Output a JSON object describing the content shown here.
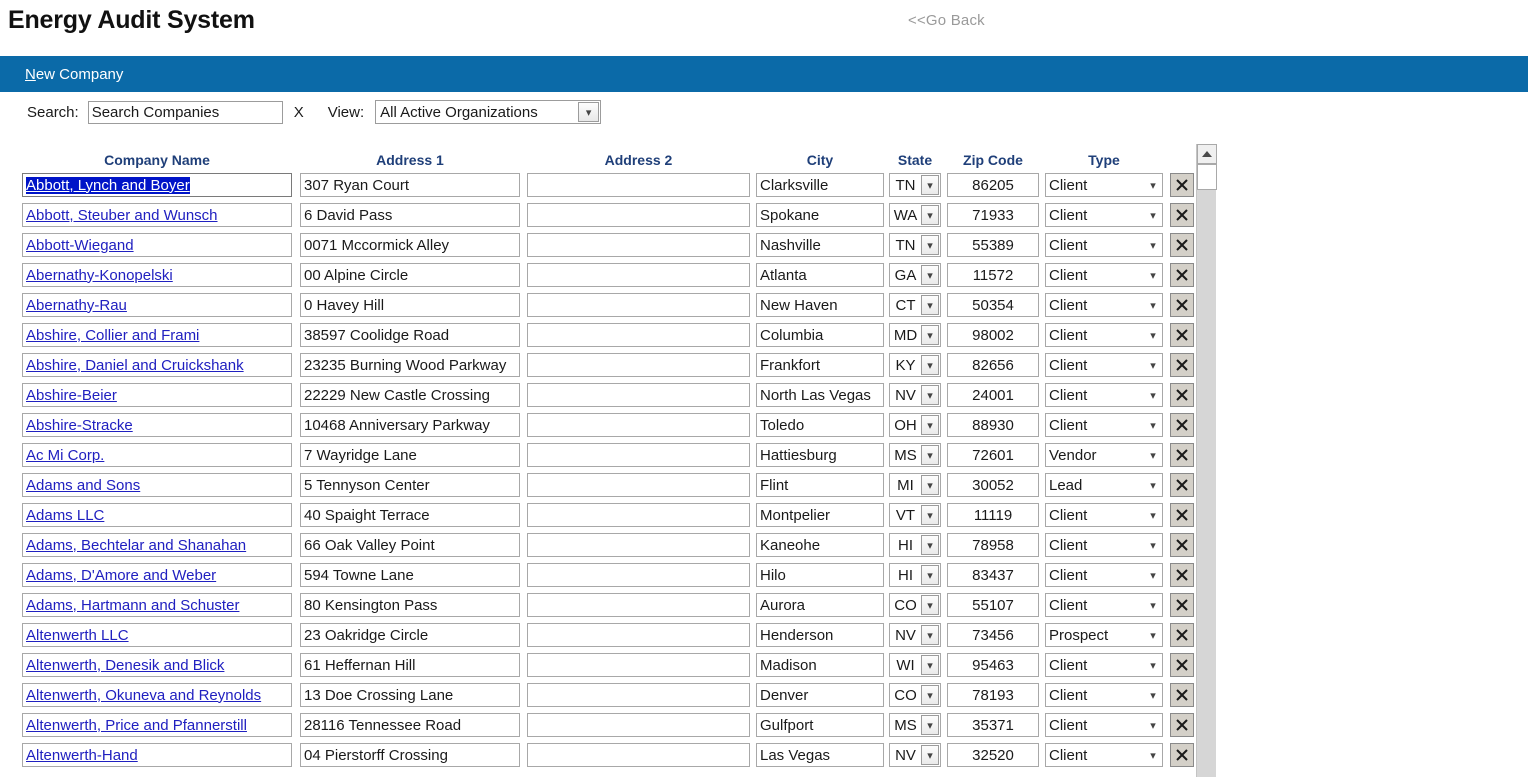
{
  "header": {
    "title": "Energy Audit System",
    "go_back_label": "<<Go Back"
  },
  "navbar": {
    "new_company_accel": "N",
    "new_company_rest": "ew Company"
  },
  "toolbar": {
    "search_label": "Search:",
    "search_value": "Search Companies",
    "search_placeholder": "Search Companies",
    "clear_label": "X",
    "view_label": "View:",
    "view_selected": "All Active Organizations",
    "view_options": [
      "All Active Organizations"
    ]
  },
  "grid": {
    "columns": [
      "Company Name",
      "Address 1",
      "Address 2",
      "City",
      "State",
      "Zip Code",
      "Type"
    ],
    "delete_icon": "x-icon",
    "selected_row_index": 0,
    "rows": [
      {
        "name": "Abbott, Lynch and Boyer",
        "address1": "307 Ryan Court",
        "address2": "",
        "city": "Clarksville",
        "state": "TN",
        "zip": "86205",
        "type": "Client"
      },
      {
        "name": "Abbott, Steuber and Wunsch",
        "address1": "6 David Pass",
        "address2": "",
        "city": "Spokane",
        "state": "WA",
        "zip": "71933",
        "type": "Client"
      },
      {
        "name": "Abbott-Wiegand",
        "address1": "0071 Mccormick Alley",
        "address2": "",
        "city": "Nashville",
        "state": "TN",
        "zip": "55389",
        "type": "Client"
      },
      {
        "name": "Abernathy-Konopelski",
        "address1": "00 Alpine Circle",
        "address2": "",
        "city": "Atlanta",
        "state": "GA",
        "zip": "11572",
        "type": "Client"
      },
      {
        "name": "Abernathy-Rau",
        "address1": "0 Havey Hill",
        "address2": "",
        "city": "New Haven",
        "state": "CT",
        "zip": "50354",
        "type": "Client"
      },
      {
        "name": "Abshire, Collier and Frami",
        "address1": "38597 Coolidge Road",
        "address2": "",
        "city": "Columbia",
        "state": "MD",
        "zip": "98002",
        "type": "Client"
      },
      {
        "name": "Abshire, Daniel and Cruickshank",
        "address1": "23235 Burning Wood Parkway",
        "address2": "",
        "city": "Frankfort",
        "state": "KY",
        "zip": "82656",
        "type": "Client"
      },
      {
        "name": "Abshire-Beier",
        "address1": "22229 New Castle Crossing",
        "address2": "",
        "city": "North Las Vegas",
        "state": "NV",
        "zip": "24001",
        "type": "Client"
      },
      {
        "name": "Abshire-Stracke",
        "address1": "10468 Anniversary Parkway",
        "address2": "",
        "city": "Toledo",
        "state": "OH",
        "zip": "88930",
        "type": "Client"
      },
      {
        "name": "Ac Mi Corp.",
        "address1": "7 Wayridge Lane",
        "address2": "",
        "city": "Hattiesburg",
        "state": "MS",
        "zip": "72601",
        "type": "Vendor"
      },
      {
        "name": "Adams and Sons",
        "address1": "5 Tennyson Center",
        "address2": "",
        "city": "Flint",
        "state": "MI",
        "zip": "30052",
        "type": "Lead"
      },
      {
        "name": "Adams LLC",
        "address1": "40 Spaight Terrace",
        "address2": "",
        "city": "Montpelier",
        "state": "VT",
        "zip": "11119",
        "type": "Client"
      },
      {
        "name": "Adams, Bechtelar and Shanahan",
        "address1": "66 Oak Valley Point",
        "address2": "",
        "city": "Kaneohe",
        "state": "HI",
        "zip": "78958",
        "type": "Client"
      },
      {
        "name": "Adams, D'Amore and Weber",
        "address1": "594 Towne Lane",
        "address2": "",
        "city": "Hilo",
        "state": "HI",
        "zip": "83437",
        "type": "Client"
      },
      {
        "name": "Adams, Hartmann and Schuster",
        "address1": "80 Kensington Pass",
        "address2": "",
        "city": "Aurora",
        "state": "CO",
        "zip": "55107",
        "type": "Client"
      },
      {
        "name": "Altenwerth LLC",
        "address1": "23 Oakridge Circle",
        "address2": "",
        "city": "Henderson",
        "state": "NV",
        "zip": "73456",
        "type": "Prospect"
      },
      {
        "name": "Altenwerth, Denesik and Blick",
        "address1": "61 Heffernan Hill",
        "address2": "",
        "city": "Madison",
        "state": "WI",
        "zip": "95463",
        "type": "Client"
      },
      {
        "name": "Altenwerth, Okuneva and Reynolds",
        "address1": "13 Doe Crossing Lane",
        "address2": "",
        "city": "Denver",
        "state": "CO",
        "zip": "78193",
        "type": "Client"
      },
      {
        "name": "Altenwerth, Price and Pfannerstill",
        "address1": "28116 Tennessee Road",
        "address2": "",
        "city": "Gulfport",
        "state": "MS",
        "zip": "35371",
        "type": "Client"
      },
      {
        "name": "Altenwerth-Hand",
        "address1": "04 Pierstorff Crossing",
        "address2": "",
        "city": "Las Vegas",
        "state": "NV",
        "zip": "32520",
        "type": "Client"
      }
    ]
  },
  "scrollbar": {
    "up_arrow": "triangle-up-icon"
  },
  "colors": {
    "navbar_blue": "#0b6aa8",
    "header_text_blue": "#1f3f79",
    "link_blue": "#2020c0",
    "selection_blue": "#0014c8"
  }
}
